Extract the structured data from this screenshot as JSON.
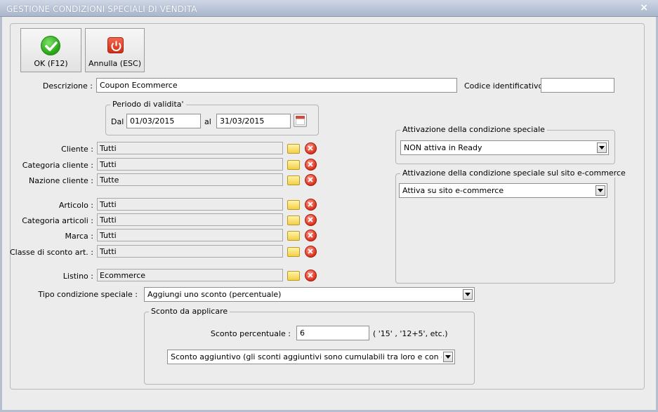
{
  "window": {
    "title": "GESTIONE CONDIZIONI SPECIALI DI VENDITA",
    "close_glyph": "×"
  },
  "toolbar": {
    "ok_label": "OK (F12)",
    "ok_icon": "checkmark-icon",
    "cancel_label": "Annulla (ESC)",
    "cancel_icon": "power-icon"
  },
  "descrizione": {
    "label": "Descrizione :",
    "value": "Coupon Ecommerce"
  },
  "codice": {
    "label": "Codice identificativo :",
    "value": ""
  },
  "periodo": {
    "title": "Periodo di validita'",
    "dal_label": "Dal",
    "dal_value": "01/03/2015",
    "al_label": "al",
    "al_value": "31/03/2015"
  },
  "fields": [
    {
      "label": "Cliente :",
      "value": "Tutti"
    },
    {
      "label": "Categoria cliente :",
      "value": "Tutti"
    },
    {
      "label": "Nazione cliente :",
      "value": "Tutte"
    },
    {
      "label": "Articolo :",
      "value": "Tutti"
    },
    {
      "label": "Categoria articoli :",
      "value": "Tutti"
    },
    {
      "label": "Marca :",
      "value": "Tutti"
    },
    {
      "label": "Classe di sconto art. :",
      "value": "Tutti"
    },
    {
      "label": "Listino :",
      "value": "Ecommerce"
    }
  ],
  "attivazione": {
    "title": "Attivazione della condizione speciale",
    "selected": "NON attiva in Ready"
  },
  "attivazione_ecommerce": {
    "title": "Attivazione della condizione speciale sul sito e-commerce",
    "selected": "Attiva su sito e-commerce"
  },
  "tipo": {
    "label": "Tipo condizione speciale :",
    "selected": "Aggiungi uno sconto (percentuale)"
  },
  "sconto": {
    "title": "Sconto da applicare",
    "percent_label": "Sconto percentuale :",
    "percent_value": "6",
    "hint": "( '15' ,  '12+5', etc.)",
    "mode_selected": "Sconto aggiuntivo (gli sconti aggiuntivi sono cumulabili tra loro e con gli sconti prir"
  }
}
